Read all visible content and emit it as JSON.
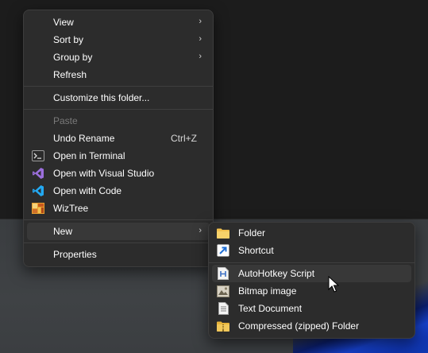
{
  "context_menu": {
    "items": [
      {
        "label": "View",
        "has_submenu": true
      },
      {
        "label": "Sort by",
        "has_submenu": true
      },
      {
        "label": "Group by",
        "has_submenu": true
      },
      {
        "label": "Refresh"
      },
      {
        "label": "Customize this folder..."
      },
      {
        "label": "Paste",
        "disabled": true
      },
      {
        "label": "Undo Rename",
        "shortcut": "Ctrl+Z"
      },
      {
        "label": "Open in Terminal",
        "icon": "terminal-icon"
      },
      {
        "label": "Open with Visual Studio",
        "icon": "visual-studio-icon"
      },
      {
        "label": "Open with Code",
        "icon": "vscode-icon"
      },
      {
        "label": "WizTree",
        "icon": "wiztree-icon"
      },
      {
        "label": "New",
        "has_submenu": true,
        "highlighted": true
      },
      {
        "label": "Properties"
      }
    ]
  },
  "new_submenu": {
    "items": [
      {
        "label": "Folder",
        "icon": "folder-icon"
      },
      {
        "label": "Shortcut",
        "icon": "shortcut-icon"
      },
      {
        "label": "AutoHotkey Script",
        "icon": "autohotkey-icon",
        "highlighted": true
      },
      {
        "label": "Bitmap image",
        "icon": "bitmap-icon"
      },
      {
        "label": "Text Document",
        "icon": "text-document-icon"
      },
      {
        "label": "Compressed (zipped) Folder",
        "icon": "zip-folder-icon"
      }
    ]
  },
  "colors": {
    "menu_bg": "#2c2c2c",
    "highlight": "#383838",
    "folder": "#f2c14e",
    "vscode": "#23a9f2",
    "visual_studio": "#9b6fdc"
  },
  "glyphs": {
    "chevron": "›"
  }
}
